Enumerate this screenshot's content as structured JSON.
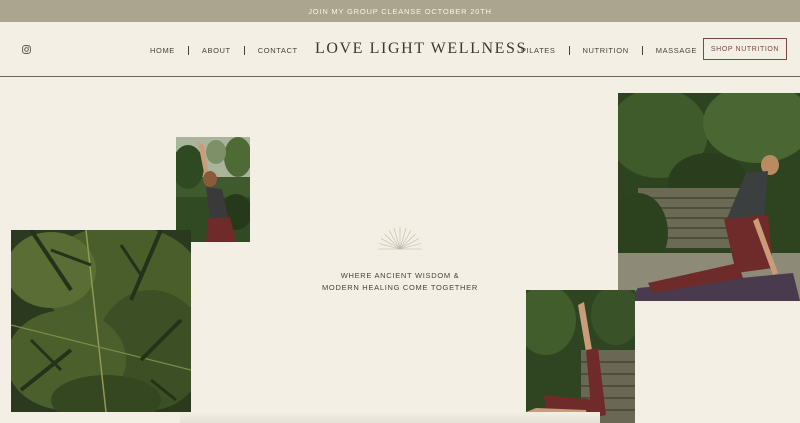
{
  "announcement": "JOIN MY GROUP CLEANSE OCTOBER 20TH",
  "header": {
    "logo": "LOVE LIGHT WELLNESS",
    "nav_left": [
      "HOME",
      "ABOUT",
      "CONTACT"
    ],
    "nav_right": [
      "PILATES",
      "NUTRITION",
      "MASSAGE"
    ],
    "shop_button": "SHOP NUTRITION",
    "social_icon": "instagram-icon"
  },
  "hero": {
    "tagline_line1": "WHERE ANCIENT WISDOM &",
    "tagline_line2": "MODERN HEALING COME TOGETHER",
    "ornament_icon": "sunburst-icon"
  },
  "colors": {
    "background": "#f3efe4",
    "announcement_bar": "#aba48e",
    "accent": "#7a4a40",
    "text": "#4a4238"
  }
}
